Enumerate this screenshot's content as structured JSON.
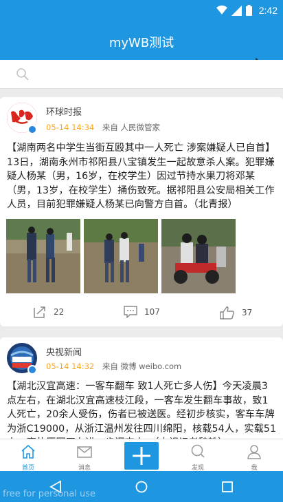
{
  "status": {
    "time": "2:42"
  },
  "app": {
    "title": "myWB测试"
  },
  "search": {
    "icon": "search-icon"
  },
  "posts": [
    {
      "author": "环球时报",
      "time": "05-14 14:34",
      "source": "来自 人民微管家",
      "text": "【湖南两名中学生当街互殴其中一人死亡 涉案嫌疑人已自首】13日，湖南永州市祁阳县八宝镇发生一起故意杀人案。犯罪嫌疑人杨某（男，16岁，在校学生）因过节持水果刀将邓某（男，13岁，在校学生）捅伤致死。据祁阳县公安局相关工作人员，目前犯罪嫌疑人杨某已向警方自首。（北青报）",
      "repost_count": "22",
      "comment_count": "107",
      "like_count": "37"
    },
    {
      "author": "央视新闻",
      "time": "05-14 14:32",
      "source": "来自 微博 weibo.com",
      "text": "【湖北汉宜高速：一客车翻车 致1人死亡多人伤】今天凌晨3点左右，在湖北汉宜高速枝江段，一客车发生翻车事故，致1人死亡，20余人受伤，伤者已被送医。经初步核实，客车车牌为浙C19000，从浙江温州发往四川绵阳，核载54人，实载51人。事故原因正在进一步调查中。（央视记者魏轶）"
    }
  ],
  "tabs": [
    {
      "label": "首页",
      "icon": "home-icon"
    },
    {
      "label": "消息",
      "icon": "mail-icon"
    },
    {
      "label": "",
      "icon": "plus-icon"
    },
    {
      "label": "发现",
      "icon": "search-icon"
    },
    {
      "label": "我",
      "icon": "person-icon"
    }
  ],
  "navbar": {
    "watermark": "free for personal use"
  },
  "colors": {
    "primary": "#1e96e0",
    "time_accent": "#f5a623"
  }
}
